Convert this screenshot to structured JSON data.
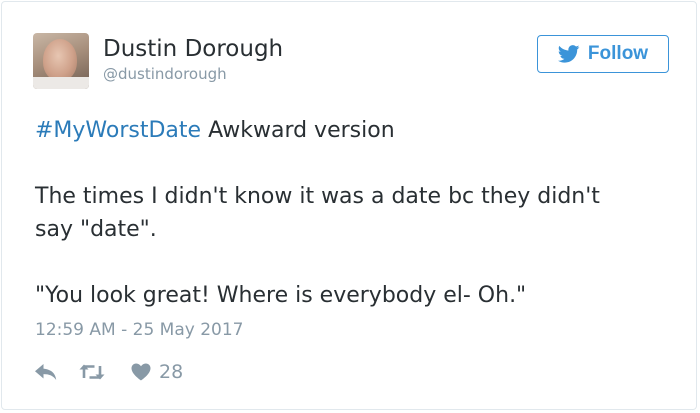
{
  "author": {
    "name": "Dustin Dorough",
    "handle": "@dustindorough"
  },
  "follow_button": {
    "label": "Follow"
  },
  "tweet": {
    "hashtag": "#MyWorstDate",
    "line1_rest": " Awkward version",
    "paragraph2": "The times I didn't know it was a date bc they didn't",
    "paragraph2_cont": "say \"date\".",
    "paragraph3": "\"You look great! Where is everybody el- Oh.\"",
    "timestamp": "12:59 AM - 25 May 2017"
  },
  "actions": {
    "like_count": "28",
    "icons": [
      "reply-icon",
      "retweet-icon",
      "heart-icon"
    ]
  },
  "colors": {
    "link": "#2b7bb9",
    "follow_accent": "#3b94d9",
    "muted": "#8899a6",
    "text": "#292f33"
  }
}
